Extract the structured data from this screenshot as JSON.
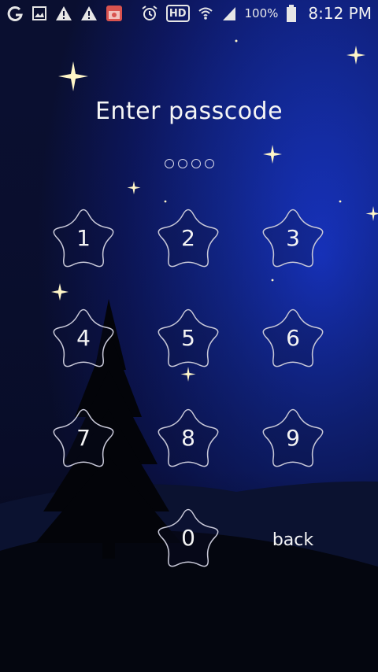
{
  "status_bar": {
    "icons_left": [
      "swirl-app-icon",
      "image-icon",
      "warning-icon",
      "warning-icon",
      "calendar-app-icon"
    ],
    "icons_right": [
      "alarm-icon",
      "hd-icon",
      "wifi-icon",
      "signal-icon",
      "battery-icon"
    ],
    "hd_label": "HD",
    "battery": "100%",
    "time": "8:12 PM"
  },
  "lock": {
    "title": "Enter passcode",
    "dot_count": 4,
    "keys": [
      "1",
      "2",
      "3",
      "4",
      "5",
      "6",
      "7",
      "8",
      "9",
      "0"
    ],
    "back_label": "back"
  },
  "colors": {
    "star_outline": "#c8c8d8",
    "sky_top": "#0b1030",
    "sky_glow": "#1531c8"
  }
}
